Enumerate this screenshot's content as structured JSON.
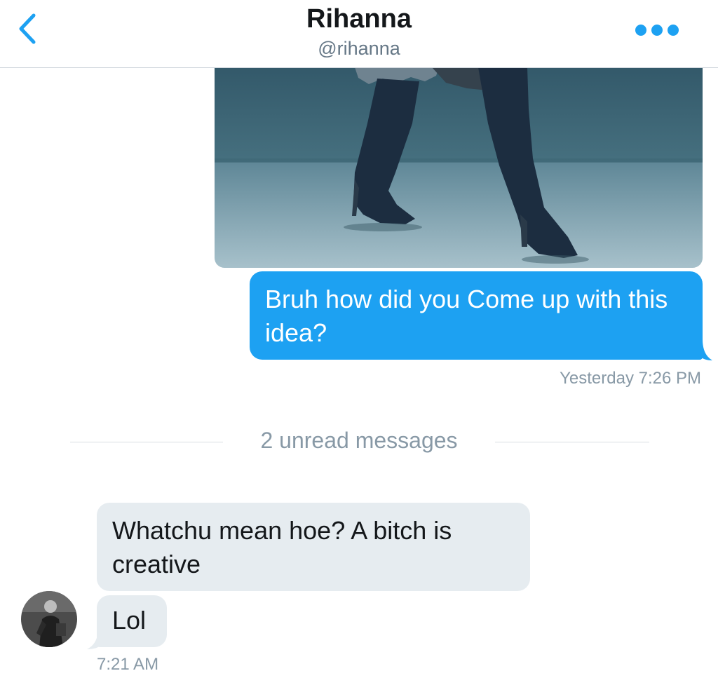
{
  "header": {
    "title": "Rihanna",
    "handle": "@rihanna",
    "back_icon": "chevron-left-icon",
    "more_icon": "more-dots-icon"
  },
  "messages": {
    "outgoing": {
      "text": "Bruh how did you Come up with this idea?",
      "timestamp": "Yesterday 7:26 PM"
    },
    "divider": "2 unread messages",
    "incoming": [
      {
        "text": "Whatchu mean hoe? A bitch is creative"
      },
      {
        "text": "Lol"
      }
    ],
    "incoming_timestamp": "7:21 AM"
  },
  "colors": {
    "accent": "#1da1f2",
    "incoming_bubble": "#e6ecf0",
    "muted_text": "#8899a6"
  }
}
